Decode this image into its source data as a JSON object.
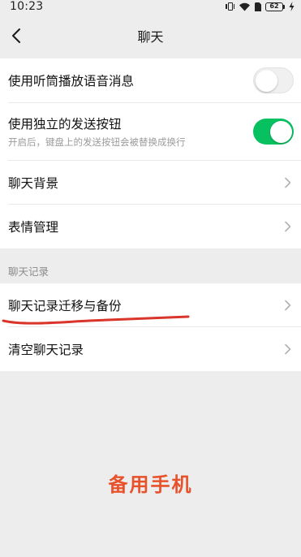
{
  "status_bar": {
    "time": "10:23",
    "battery_level": "62"
  },
  "nav": {
    "title": "聊天"
  },
  "settings": {
    "listen_earpiece": {
      "label": "使用听筒播放语音消息",
      "enabled": false
    },
    "separate_send_button": {
      "label": "使用独立的发送按钮",
      "description": "开启后，键盘上的发送按钮会被替换成换行",
      "enabled": true
    },
    "chat_background": {
      "label": "聊天背景"
    },
    "sticker_management": {
      "label": "表情管理"
    }
  },
  "chat_history_section": {
    "header": "聊天记录",
    "migrate_backup": {
      "label": "聊天记录迁移与备份"
    },
    "clear_history": {
      "label": "清空聊天记录"
    }
  },
  "overlay": {
    "label": "备用手机"
  },
  "colors": {
    "toggle_on": "#07c160",
    "annotation": "#d9352a",
    "overlay_text": "#e8522b"
  },
  "icons": [
    "vibrate-icon",
    "wifi-icon",
    "sim-icon",
    "battery-icon",
    "charging-icon",
    "back-arrow-icon",
    "chevron-right-icon"
  ]
}
